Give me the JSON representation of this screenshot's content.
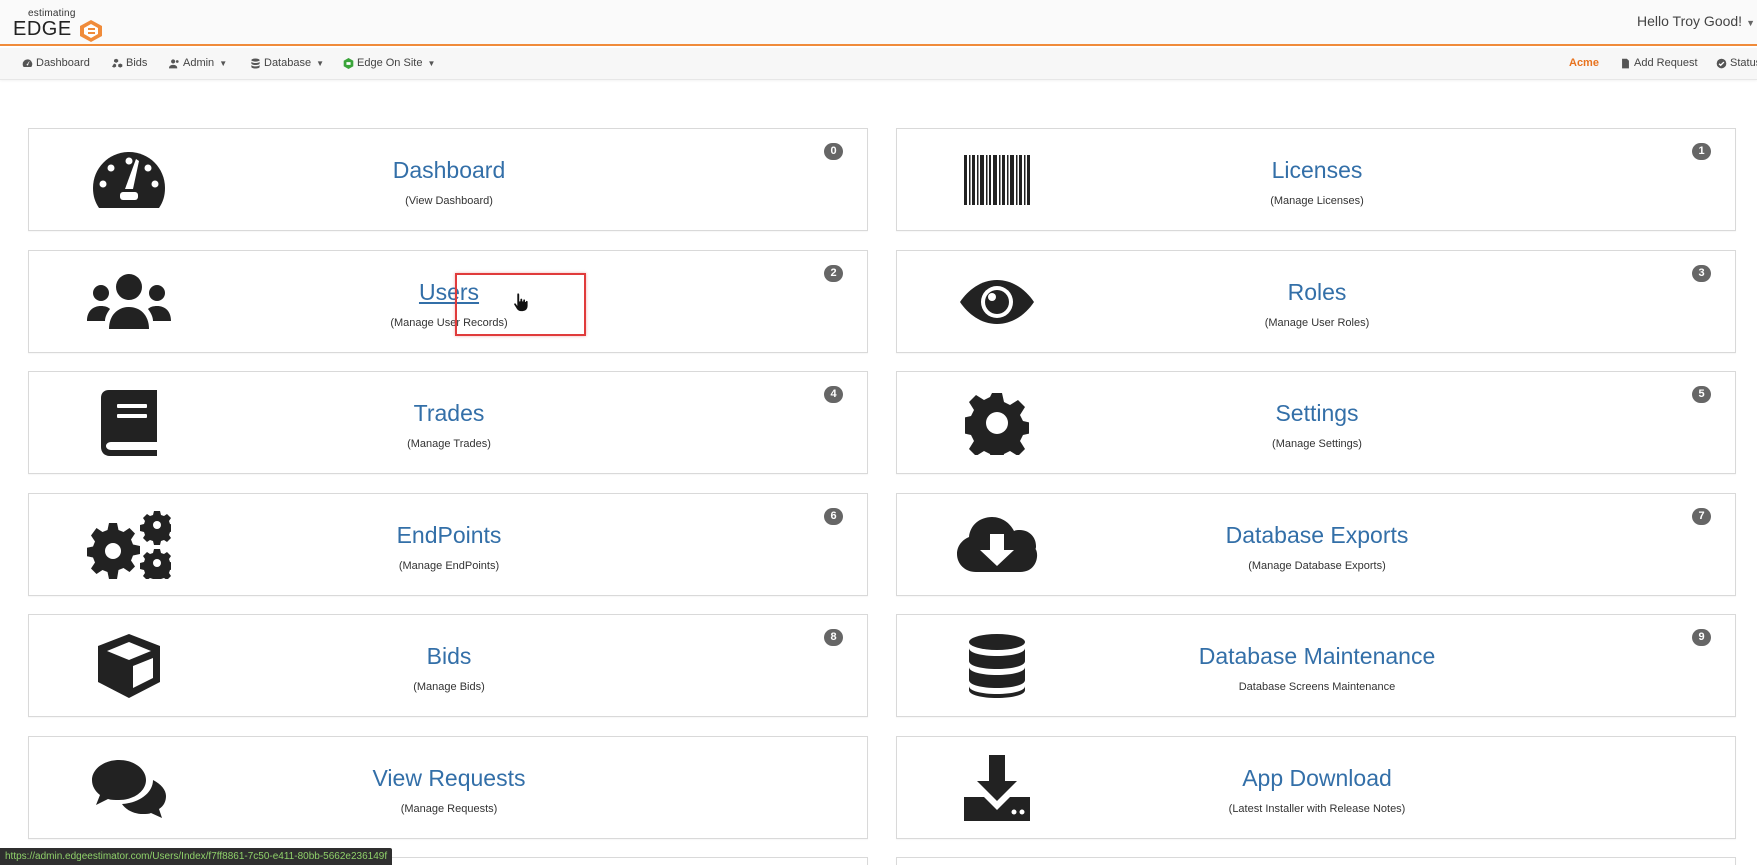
{
  "header": {
    "logo_small": "estimating",
    "logo_big": "EDGE",
    "greeting": "Hello Troy Good!"
  },
  "nav": {
    "left": [
      {
        "label": "Dashboard",
        "icon": "dashboard-icon"
      },
      {
        "label": "Bids",
        "icon": "cubes-icon"
      },
      {
        "label": "Admin",
        "icon": "user-group-icon",
        "dropdown": true
      },
      {
        "label": "Database",
        "icon": "database-icon",
        "dropdown": true
      },
      {
        "label": "Edge On Site",
        "icon": "edge-logo-icon",
        "dropdown": true
      }
    ],
    "right": [
      {
        "label": "Acme"
      },
      {
        "label": "Add Request",
        "icon": "document-icon"
      },
      {
        "label": "Status",
        "icon": "check-circle-icon"
      }
    ]
  },
  "tiles": [
    {
      "title": "Dashboard",
      "sub": "(View Dashboard)",
      "badge": "0",
      "icon": "tachometer-icon"
    },
    {
      "title": "Licenses",
      "sub": "(Manage Licenses)",
      "badge": "1",
      "icon": "barcode-icon"
    },
    {
      "title": "Users",
      "sub": "(Manage User Records)",
      "badge": "2",
      "icon": "users-icon"
    },
    {
      "title": "Roles",
      "sub": "(Manage User Roles)",
      "badge": "3",
      "icon": "eye-icon"
    },
    {
      "title": "Trades",
      "sub": "(Manage Trades)",
      "badge": "4",
      "icon": "book-icon"
    },
    {
      "title": "Settings",
      "sub": "(Manage Settings)",
      "badge": "5",
      "icon": "gear-icon"
    },
    {
      "title": "EndPoints",
      "sub": "(Manage EndPoints)",
      "badge": "6",
      "icon": "gears-icon"
    },
    {
      "title": "Database Exports",
      "sub": "(Manage Database Exports)",
      "badge": "7",
      "icon": "cloud-download-icon"
    },
    {
      "title": "Bids",
      "sub": "(Manage Bids)",
      "badge": "8",
      "icon": "cube-icon"
    },
    {
      "title": "Database Maintenance",
      "sub": "Database Screens Maintenance",
      "badge": "9",
      "icon": "database-icon"
    },
    {
      "title": "View Requests",
      "sub": "(Manage Requests)",
      "icon": "comments-icon"
    },
    {
      "title": "App Download",
      "sub": "(Latest Installer with Release Notes)",
      "icon": "download-icon"
    }
  ],
  "status_url": "https://admin.edgeestimator.com/Users/Index/f7ff8861-7c50-e411-80bb-5662e236149f",
  "colors": {
    "accent": "#f08b3a",
    "link": "#336fa8",
    "badge": "#666666",
    "highlight": "#e03b3b"
  }
}
